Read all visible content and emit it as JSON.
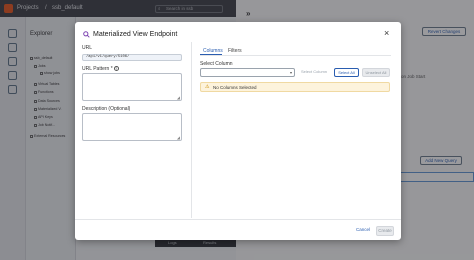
{
  "app": {
    "breadcrumb_projects": "Projects",
    "breadcrumb_sep": "/",
    "breadcrumb_project": "ssb_default",
    "search_placeholder": "Search in ssb",
    "explorer_title": "Explorer",
    "tree": [
      "ssb_default",
      "Jobs",
      "show jobs",
      "Virtual Tables",
      "Functions",
      "Data Sources",
      "Materialized V.",
      "API Keys",
      "Job Notif...",
      "External Resources"
    ],
    "revert_label": "Revert Changes",
    "run_label": "on Job Start",
    "add_query_label": "Add New Query",
    "bottom_tabs": [
      "Logs",
      "Results"
    ]
  },
  "modal": {
    "title": "Materialized View Endpoint",
    "url_label": "URL",
    "url_value": "/api/v1/query/5106/",
    "url_pattern_label": "URL Pattern *",
    "description_label": "Description (Optional)",
    "tabs": [
      "Columns",
      "Filters"
    ],
    "select_column_label": "Select Column",
    "select_column_value": "",
    "select_column_button": "Select Column",
    "select_all_button": "Select All",
    "unselect_all_button": "Unselect All",
    "warning_text": "No Columns Selected",
    "cancel_label": "Cancel",
    "create_label": "Create"
  },
  "colors": {
    "accent": "#2a5db0",
    "warning_bg": "#fdf3dc",
    "brand": "#e8551c"
  }
}
